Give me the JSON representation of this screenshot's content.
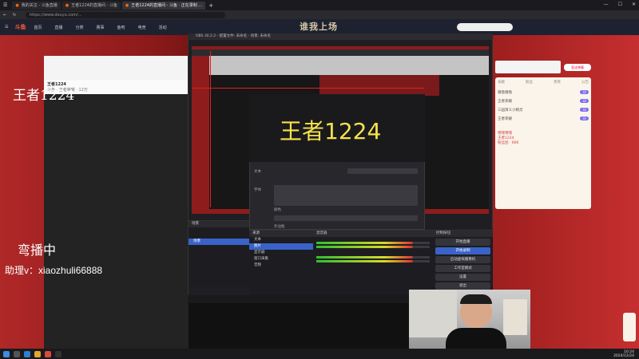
{
  "browser": {
    "tabs": [
      {
        "label": "我的关注 - 斗鱼直播"
      },
      {
        "label": "王者1224的直播间 - 斗鱼"
      },
      {
        "label": "王者1224的直播间 - 斗鱼 · 正在录制 …"
      }
    ],
    "url": "https://www.douyu.com/...",
    "win_min": "—",
    "win_max": "☐",
    "win_close": "✕"
  },
  "site": {
    "logo": "斗鱼",
    "nav": [
      "首页",
      "直播",
      "分类",
      "赛事",
      "鱼吧",
      "电竞",
      "活动"
    ],
    "banner": "谁我上场"
  },
  "room": {
    "title": "王者1224",
    "subtitle": "斗鱼 · 王者荣耀 · 12万"
  },
  "overlay": {
    "title": "王者1224",
    "mid": "弯播中",
    "wechat": "助理v：xiaozhuli66888"
  },
  "right_panel": {
    "send_label": "发送弹幕",
    "tabs": [
      "贡献",
      "粉丝",
      "贵宾",
      "公告"
    ],
    "rows": [
      "嗷嗷嗷嗷",
      "王者荣耀",
      "三国演义小精灵",
      "王者荣耀"
    ],
    "badge": "LV",
    "chat": [
      "嘿嘿嘿嘿",
      "王者1224",
      "粉丝团 · 666"
    ]
  },
  "obs": {
    "title": "OBS 30.2.2 - 配置文件: 未命名 - 场景: 未命名",
    "props_text": "王者1224",
    "props_labels": [
      "文本",
      "字体",
      "颜色",
      "外边框"
    ],
    "scenes_head": "场景",
    "scene_items": [
      "场景"
    ],
    "sources_head": "来源",
    "source_items": [
      "文本",
      "图片",
      "显示器",
      "窗口采集",
      "音频"
    ],
    "mixer_head": "混音器",
    "controls_head": "控制按钮",
    "controls": [
      "开始直播",
      "开始录制",
      "启动虚拟摄像机",
      "工作室模式",
      "设置",
      "退出"
    ],
    "status": "00:00:00   CPU: 2.3%   30.00 / 30.00 FPS"
  },
  "taskbar": {
    "time": "10:24",
    "date": "2024/12/24"
  }
}
